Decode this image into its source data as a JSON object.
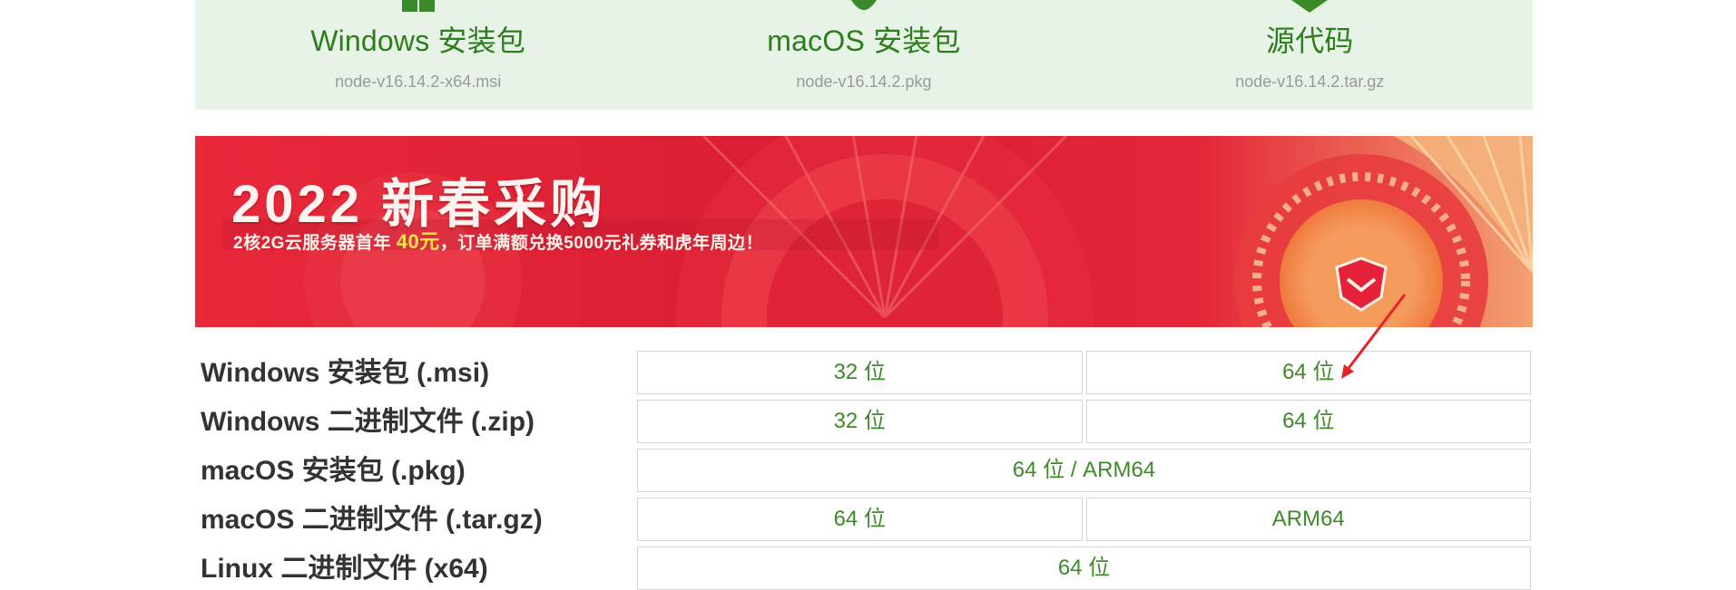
{
  "downloads": [
    {
      "title": "Windows 安装包",
      "file": "node-v16.14.2-x64.msi",
      "icon": "windows-icon"
    },
    {
      "title": "macOS 安装包",
      "file": "node-v16.14.2.pkg",
      "icon": "apple-icon"
    },
    {
      "title": "源代码",
      "file": "node-v16.14.2.tar.gz",
      "icon": "box-icon"
    }
  ],
  "banner": {
    "title": "2022 新春采购",
    "subtitle_before": "2核2G云服务器首年 ",
    "subtitle_highlight": "40元",
    "subtitle_after": "，订单满额兑换5000元礼券和虎年周边！"
  },
  "table": [
    {
      "label": "Windows 安装包 (.msi)",
      "cells": [
        "32 位",
        "64 位"
      ]
    },
    {
      "label": "Windows 二进制文件 (.zip)",
      "cells": [
        "32 位",
        "64 位"
      ]
    },
    {
      "label": "macOS 安装包 (.pkg)",
      "cells": [
        "64 位 / ARM64"
      ]
    },
    {
      "label": "macOS 二进制文件 (.tar.gz)",
      "cells": [
        "64 位",
        "ARM64"
      ]
    },
    {
      "label": "Linux 二进制文件 (x64)",
      "cells": [
        "64 位"
      ]
    }
  ],
  "colors": {
    "accent_green": "#2e7d1c",
    "card_bg": "#e6f3e6",
    "annotation_red": "#e8222b"
  }
}
